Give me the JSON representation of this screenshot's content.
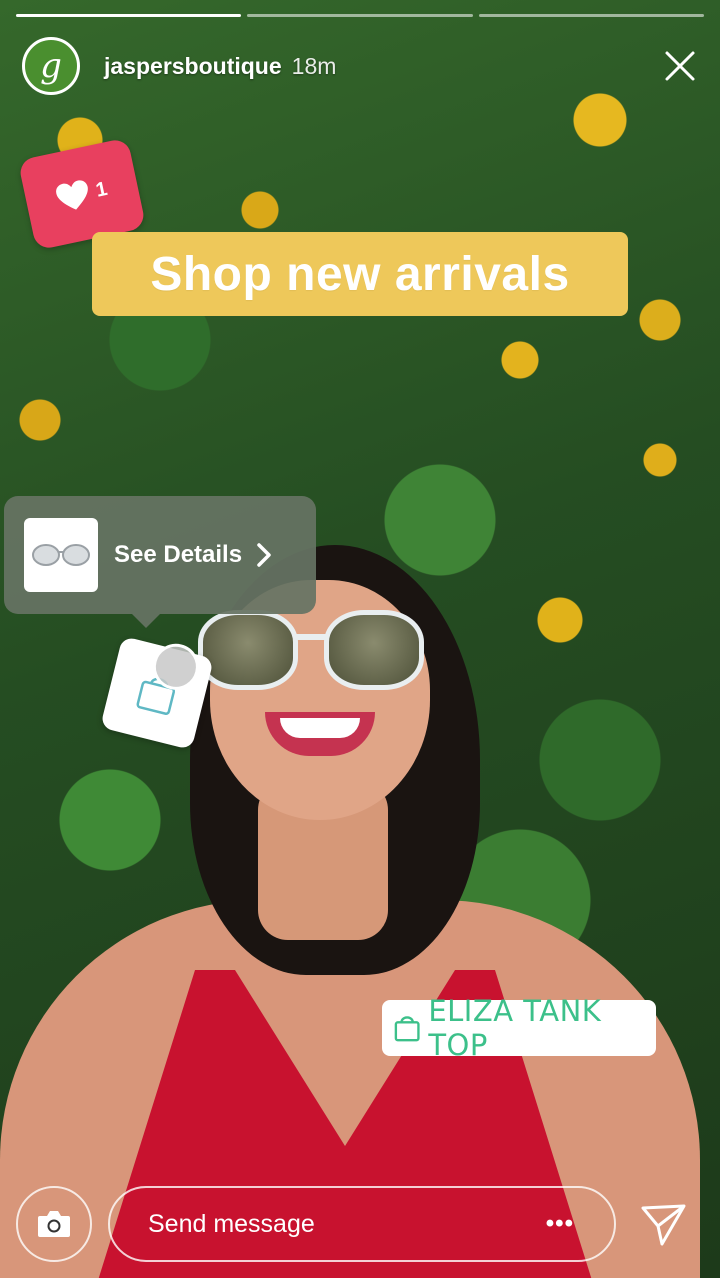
{
  "story": {
    "progress": {
      "segments": 3,
      "active_index": 0
    },
    "header": {
      "avatar_letter": "g",
      "username": "jaspersboutique",
      "time": "18m",
      "close_icon": "close-icon"
    },
    "like_sticker": {
      "count": "1",
      "icon": "heart-icon",
      "color": "#e8405f"
    },
    "promo_text": "Shop new arrivals",
    "product_card": {
      "label": "See Details",
      "thumbnail": "sunglasses-icon",
      "icon": "chevron-right-icon"
    },
    "shopping_tag": {
      "icon": "shopping-bag-icon"
    },
    "product_sticker": {
      "label": "ELIZA TANK TOP",
      "icon": "shopping-bag-icon",
      "color": "#3cc08a"
    }
  },
  "footer": {
    "camera_icon": "camera-icon",
    "message_placeholder": "Send message",
    "more_label": "•••",
    "send_icon": "send-icon"
  }
}
